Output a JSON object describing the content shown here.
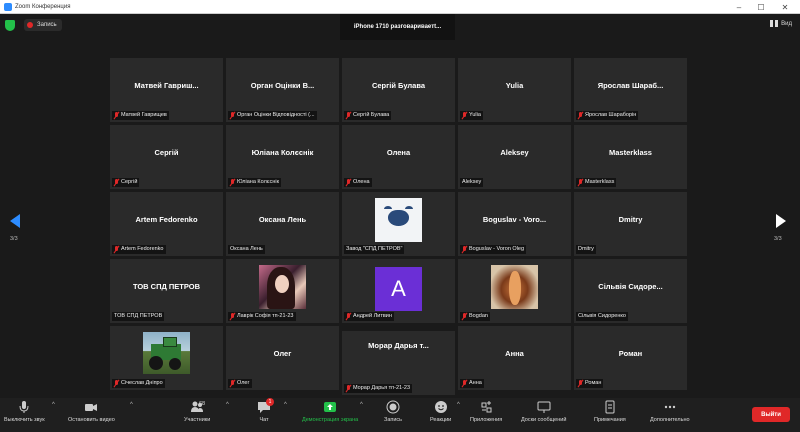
{
  "window": {
    "title": "Zoom Конференция"
  },
  "topbar": {
    "recording_label": "Запись",
    "speaker_banner": "iPhone 1710 разговариваетt...",
    "view_label": "Вид"
  },
  "pagination": {
    "left": "3/3",
    "right": "3/3"
  },
  "tiles": [
    {
      "name": "Матвей  Гавриш...",
      "label": "Матвей Гаврищев",
      "muted": true
    },
    {
      "name": "Орган  Оцінки  В...",
      "label": "Орган Оцінки Відповідності (...",
      "muted": true
    },
    {
      "name": "Сергій Булава",
      "label": "Сергій Булава",
      "muted": true
    },
    {
      "name": "Yulia",
      "label": "Yulia",
      "muted": true
    },
    {
      "name": "Ярослав  Шараб...",
      "label": "Ярослав Шараборін",
      "muted": true
    },
    {
      "name": "Сергій",
      "label": "Сергій",
      "muted": true
    },
    {
      "name": "Юліана Колєснік",
      "label": "Юліана Колєснік",
      "muted": true
    },
    {
      "name": "Олена",
      "label": "Олена",
      "muted": true
    },
    {
      "name": "Aleksey",
      "label": "Aleksey",
      "muted": false
    },
    {
      "name": "Masterklass",
      "label": "Masterklass",
      "muted": true
    },
    {
      "name": "Artem Fedorenko",
      "label": "Artem Fedorenko",
      "muted": true
    },
    {
      "name": "Оксана Лень",
      "label": "Оксана Лень",
      "muted": false
    },
    {
      "name": "",
      "label": "Завод \"СПД ПЕТРОВ\"",
      "muted": false
    },
    {
      "name": "Boguslav - Voro...",
      "label": "Boguslav - Voron Oleg",
      "muted": true
    },
    {
      "name": "Dmitry",
      "label": "Dmitry",
      "muted": false
    },
    {
      "name": "ТОВ СПД ПЕТРОВ",
      "label": "ТОВ СПД ПЕТРОВ",
      "muted": false
    },
    {
      "name": "",
      "label": "Лаврік Софія тп-21-23",
      "muted": true
    },
    {
      "name": "",
      "label": "Андрей Литвин",
      "muted": true,
      "avatar_letter": "A"
    },
    {
      "name": "",
      "label": "Bogdan",
      "muted": true
    },
    {
      "name": "Сільвія  Сидоре...",
      "label": "Сільвія Сидоренко",
      "muted": false
    },
    {
      "name": "",
      "label": "Січеслав Дніпро",
      "muted": true
    },
    {
      "name": "Олег",
      "label": "Олег",
      "muted": true
    },
    {
      "name": "Морар  Дарья  т...",
      "label": "Морар Дарья тп-21-23",
      "muted": true
    },
    {
      "name": "Анна",
      "label": "Анна",
      "muted": true
    },
    {
      "name": "Роман",
      "label": "Роман",
      "muted": true
    }
  ],
  "toolbar": {
    "mute": "Выключить звук",
    "video": "Остановить видео",
    "participants": "Участники",
    "participants_count": "68",
    "chat": "Чат",
    "chat_badge": "1",
    "share": "Демонстрация экрана",
    "record": "Запись",
    "reactions": "Реакции",
    "apps": "Приложения",
    "whiteboards": "Доски сообщений",
    "notes": "Примечания",
    "more": "Дополнительно",
    "leave": "Выйти"
  },
  "colors": {
    "accent": "#2d8cff",
    "share_green": "#23c04a",
    "danger": "#e02828",
    "avatar_purple": "#6b2fd6"
  }
}
